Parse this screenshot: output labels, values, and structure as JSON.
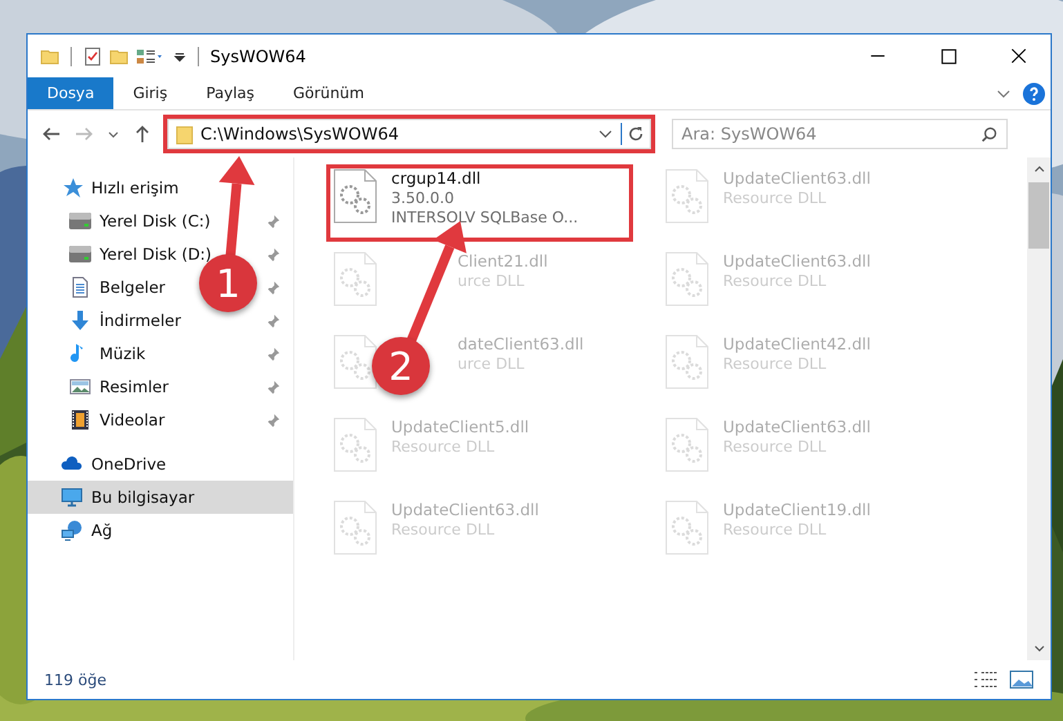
{
  "window": {
    "title": "SysWOW64"
  },
  "ribbon_tabs": [
    {
      "label": "Dosya",
      "selected": true
    },
    {
      "label": "Giriş",
      "selected": false
    },
    {
      "label": "Paylaş",
      "selected": false
    },
    {
      "label": "Görünüm",
      "selected": false
    }
  ],
  "address": {
    "path": "C:\\Windows\\SysWOW64",
    "highlighted": true
  },
  "search": {
    "placeholder": "Ara: SysWOW64"
  },
  "sidebar": {
    "items": [
      {
        "label": "Hızlı erişim",
        "kind": "star",
        "selected": false,
        "children": [
          {
            "label": "Yerel Disk (C:)",
            "kind": "drive",
            "selected": false,
            "pinned": true
          },
          {
            "label": "Yerel Disk (D:)",
            "kind": "drive",
            "selected": false,
            "pinned": true
          },
          {
            "label": "Belgeler",
            "kind": "document",
            "selected": false,
            "pinned": true
          },
          {
            "label": "İndirmeler",
            "kind": "download",
            "selected": false,
            "pinned": true
          },
          {
            "label": "Müzik",
            "kind": "music",
            "selected": false,
            "pinned": true
          },
          {
            "label": "Resimler",
            "kind": "pictures",
            "selected": false,
            "pinned": true
          },
          {
            "label": "Videolar",
            "kind": "video",
            "selected": false,
            "pinned": true
          }
        ]
      },
      {
        "label": "OneDrive",
        "kind": "cloud",
        "selected": false
      },
      {
        "label": "Bu bilgisayar",
        "kind": "computer",
        "selected": true
      },
      {
        "label": "Ağ",
        "kind": "network",
        "selected": false
      }
    ]
  },
  "files": [
    {
      "name": "crgup14.dll",
      "version": "3.50.0.0",
      "description": "INTERSOLV SQLBase O...",
      "highlighted": true
    },
    {
      "name": "UpdateClient63.dll",
      "description": "Resource DLL",
      "highlighted": false
    },
    {
      "name": "Client21.dll",
      "description": "urce DLL",
      "highlighted": false,
      "kind": "covered"
    },
    {
      "name": "UpdateClient63.dll",
      "description": "Resource DLL",
      "highlighted": false
    },
    {
      "name": "dateClient63.dll",
      "description": "urce DLL",
      "highlighted": false,
      "kind": "covered"
    },
    {
      "name": "UpdateClient42.dll",
      "description": "Resource DLL",
      "highlighted": false
    },
    {
      "name": "UpdateClient5.dll",
      "description": "Resource DLL",
      "highlighted": false
    },
    {
      "name": "UpdateClient63.dll",
      "description": "Resource DLL",
      "highlighted": false
    },
    {
      "name": "UpdateClient63.dll",
      "description": "Resource DLL",
      "highlighted": false
    },
    {
      "name": "UpdateClient19.dll",
      "description": "Resource DLL",
      "highlighted": false
    }
  ],
  "status_bar": {
    "count": "119 öğe"
  },
  "annotations": [
    {
      "number": "1"
    },
    {
      "number": "2"
    }
  ]
}
